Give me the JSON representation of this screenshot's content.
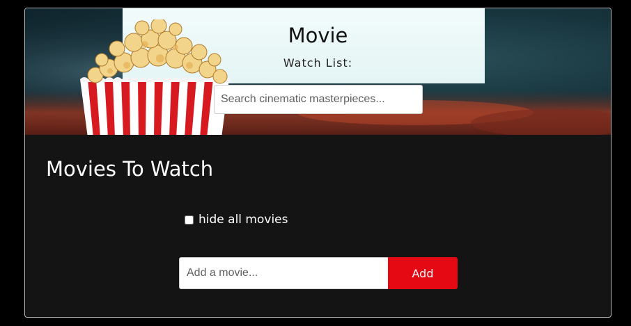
{
  "header": {
    "title": "Movie",
    "subtitle": "Watch List:",
    "search_placeholder": "Search cinematic masterpieces..."
  },
  "main": {
    "heading": "Movies To Watch",
    "hide_toggle": {
      "label": "hide all movies",
      "checked": false
    },
    "add_form": {
      "input_placeholder": "Add a movie...",
      "input_value": "",
      "button_label": "Add"
    }
  },
  "colors": {
    "accent": "#e50914",
    "background": "#141414",
    "page_background": "#000000"
  },
  "icons": {
    "hero_image": "popcorn-bucket-image"
  }
}
